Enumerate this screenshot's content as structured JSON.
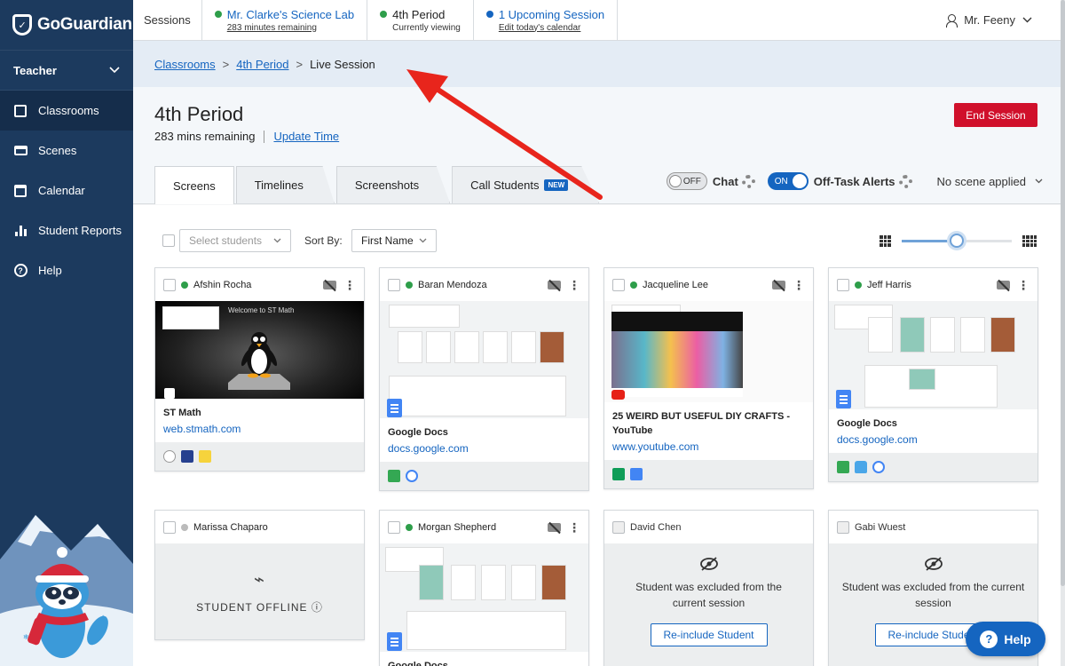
{
  "brand": {
    "name": "GoGuardian"
  },
  "sidebar": {
    "role": "Teacher",
    "items": [
      {
        "label": "Classrooms"
      },
      {
        "label": "Scenes"
      },
      {
        "label": "Calendar"
      },
      {
        "label": "Student Reports"
      },
      {
        "label": "Help"
      }
    ]
  },
  "topbar": {
    "sessions_label": "Sessions",
    "session1": {
      "title": "Mr. Clarke's Science Lab",
      "sub": "283 minutes remaining",
      "dot": "#2e9e4a"
    },
    "session2": {
      "title": "4th Period",
      "sub": "Currently viewing",
      "dot": "#2e9e4a"
    },
    "session3": {
      "title": "1 Upcoming Session",
      "sub": "Edit today's calendar",
      "dot": "#1565c0"
    },
    "user": "Mr. Feeny"
  },
  "breadcrumb": {
    "c1": "Classrooms",
    "c2": "4th Period",
    "c3": "Live Session",
    "sep": ">"
  },
  "header": {
    "title": "4th Period",
    "remaining": "283 mins remaining",
    "update_time": "Update Time",
    "end_session": "End Session"
  },
  "tabs": [
    {
      "label": "Screens"
    },
    {
      "label": "Timelines"
    },
    {
      "label": "Screenshots"
    },
    {
      "label": "Call Students",
      "badge": "NEW"
    }
  ],
  "toggles": {
    "chat": {
      "state": "OFF",
      "label": "Chat"
    },
    "alerts": {
      "state": "ON",
      "label": "Off-Task Alerts"
    },
    "scene": "No scene applied"
  },
  "controls": {
    "select_placeholder": "Select students",
    "sort_label": "Sort By:",
    "sort_value": "First Name",
    "zoom_level": 0.5
  },
  "cards": [
    {
      "name": "Afshin Rocha",
      "status": "#2e9e4a",
      "thumb_text": "Welcome to ST Math",
      "title": "ST Math",
      "url": "web.stmath.com"
    },
    {
      "name": "Baran Mendoza",
      "status": "#2e9e4a",
      "title": "Google Docs",
      "url": "docs.google.com"
    },
    {
      "name": "Jacqueline Lee",
      "status": "#2e9e4a",
      "title": "25 WEIRD BUT USEFUL DIY CRAFTS - YouTube",
      "url": "www.youtube.com"
    },
    {
      "name": "Jeff Harris",
      "status": "#2e9e4a",
      "title": "Google Docs",
      "url": "docs.google.com"
    },
    {
      "name": "Marissa Chaparo",
      "status": "#bbbbbb",
      "offline": "STUDENT OFFLINE ⓘ"
    },
    {
      "name": "Morgan Shepherd",
      "status": "#2e9e4a",
      "title": "Google Docs"
    },
    {
      "name": "David Chen",
      "excluded": "Student was excluded from the current session",
      "button": "Re-include Student"
    },
    {
      "name": "Gabi Wuest",
      "excluded": "Student was excluded from the current session",
      "button": "Re-include Student"
    }
  ],
  "help_button": "Help",
  "colors": {
    "accent": "#1565c0",
    "danger": "#d0102b",
    "sidebar": "#1c3a5e",
    "arrow": "#e8251c"
  }
}
